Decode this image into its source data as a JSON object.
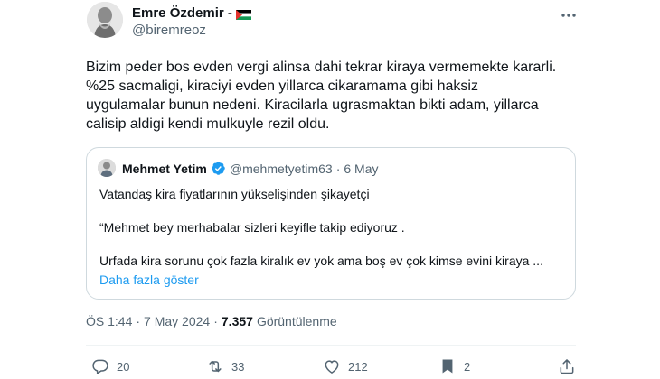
{
  "author": {
    "name": "Emre Özdemir -",
    "flag_icon": "palestine-flag-icon",
    "handle": "@biremreoz"
  },
  "tweet_text": "Bizim peder bos evden vergi alinsa dahi tekrar kiraya vermemekte kararli.\n%25 sacmaligi, kiraciyi evden yillarca cikaramama gibi haksiz\nuygulamalar bunun nedeni. Kiracilarla ugrasmaktan bikti adam, yillarca\ncalisip aldigi kendi mulkuyle rezil oldu.",
  "quote": {
    "name": "Mehmet Yetim",
    "handle": "@mehmetyetim63",
    "separator": "·",
    "date": "6 May",
    "lines": [
      "Vatandaş kira fiyatlarının yükselişinden şikayetçi",
      "“Mehmet bey merhabalar sizleri keyifle takip ediyoruz .",
      "Urfada kira sorunu çok fazla kiralık ev yok ama boş ev çok kimse evini kiraya ..."
    ],
    "show_more": "Daha fazla göster"
  },
  "meta": {
    "time": "ÖS 1:44",
    "separator": "·",
    "date": "7 May 2024",
    "separator2": "·",
    "views_count": "7.357",
    "views_label": "Görüntülenme"
  },
  "actions": {
    "replies": "20",
    "reposts": "33",
    "likes": "212",
    "bookmarks": "2"
  },
  "colors": {
    "accent": "#1d9bf0",
    "text": "#0f1419",
    "muted": "#536471",
    "border": "#cfd9de"
  }
}
